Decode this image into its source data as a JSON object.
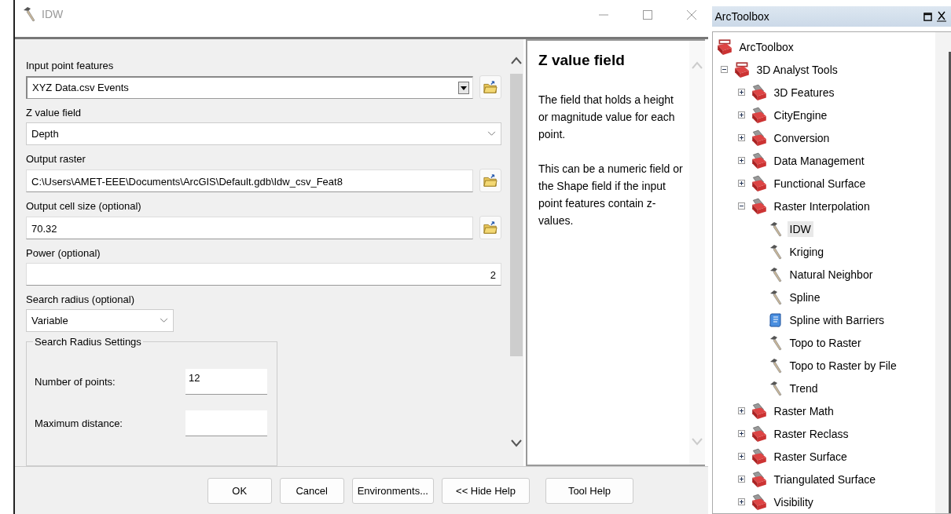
{
  "window": {
    "title": "IDW"
  },
  "form": {
    "params": [
      {
        "kind": "dropdown",
        "label": "Input point features",
        "value": "XYZ Data.csv Events",
        "browse": true
      },
      {
        "kind": "combo",
        "label": "Z value field",
        "value": "Depth",
        "browse": false
      },
      {
        "kind": "text",
        "label": "Output raster",
        "value": "C:\\Users\\AMET-EEE\\Documents\\ArcGIS\\Default.gdb\\Idw_csv_Feat8",
        "browse": true
      },
      {
        "kind": "text",
        "label": "Output cell size (optional)",
        "value": "70.32",
        "browse": true
      },
      {
        "kind": "number",
        "label": "Power (optional)",
        "value": "2",
        "browse": false
      },
      {
        "kind": "short-combo",
        "label": "Search radius (optional)",
        "value": "Variable",
        "browse": false
      }
    ],
    "group": {
      "title": "Search Radius Settings",
      "fields": [
        {
          "label": "Number of points:",
          "value": "12"
        },
        {
          "label": "Maximum distance:"
        }
      ]
    }
  },
  "help": {
    "title": "Z value field",
    "paragraphs": [
      "The field that holds a height or magnitude value for each point.",
      "This can be a numeric field or the Shape field if the input point features contain z-values."
    ]
  },
  "buttons": [
    "OK",
    "Cancel",
    "Environments...",
    "<< Hide Help"
  ],
  "help_button": "Tool Help",
  "toolbox": {
    "title": "ArcToolbox",
    "items": [
      {
        "kind": "root",
        "label": "ArcToolbox",
        "selected": false,
        "children": [
          {
            "kind": "toolbox",
            "label": "3D Analyst Tools",
            "expanded": true,
            "selected": false,
            "children": [
              {
                "kind": "toolset",
                "label": "3D Features",
                "expanded": false,
                "selected": false
              },
              {
                "kind": "toolset",
                "label": "CityEngine",
                "expanded": false,
                "selected": false
              },
              {
                "kind": "toolset",
                "label": "Conversion",
                "expanded": false,
                "selected": false
              },
              {
                "kind": "toolset",
                "label": "Data Management",
                "expanded": false,
                "selected": false
              },
              {
                "kind": "toolset",
                "label": "Functional Surface",
                "expanded": false,
                "selected": false
              },
              {
                "kind": "toolset",
                "label": "Raster Interpolation",
                "expanded": true,
                "selected": false,
                "children": [
                  {
                    "kind": "tool",
                    "label": "IDW",
                    "selected": true
                  },
                  {
                    "kind": "tool",
                    "label": "Kriging",
                    "selected": false
                  },
                  {
                    "kind": "tool",
                    "label": "Natural Neighbor",
                    "selected": false
                  },
                  {
                    "kind": "tool",
                    "label": "Spline",
                    "selected": false
                  },
                  {
                    "kind": "script",
                    "label": "Spline with Barriers",
                    "selected": false
                  },
                  {
                    "kind": "tool",
                    "label": "Topo to Raster",
                    "selected": false
                  },
                  {
                    "kind": "tool",
                    "label": "Topo to Raster by File",
                    "selected": false
                  },
                  {
                    "kind": "tool",
                    "label": "Trend",
                    "selected": false
                  }
                ]
              },
              {
                "kind": "toolset",
                "label": "Raster Math",
                "expanded": false,
                "selected": false
              },
              {
                "kind": "toolset",
                "label": "Raster Reclass",
                "expanded": false,
                "selected": false
              },
              {
                "kind": "toolset",
                "label": "Raster Surface",
                "expanded": false,
                "selected": false
              },
              {
                "kind": "toolset",
                "label": "Triangulated Surface",
                "expanded": false,
                "selected": false
              },
              {
                "kind": "toolset",
                "label": "Visibility",
                "expanded": false,
                "selected": false
              }
            ]
          }
        ]
      }
    ]
  }
}
